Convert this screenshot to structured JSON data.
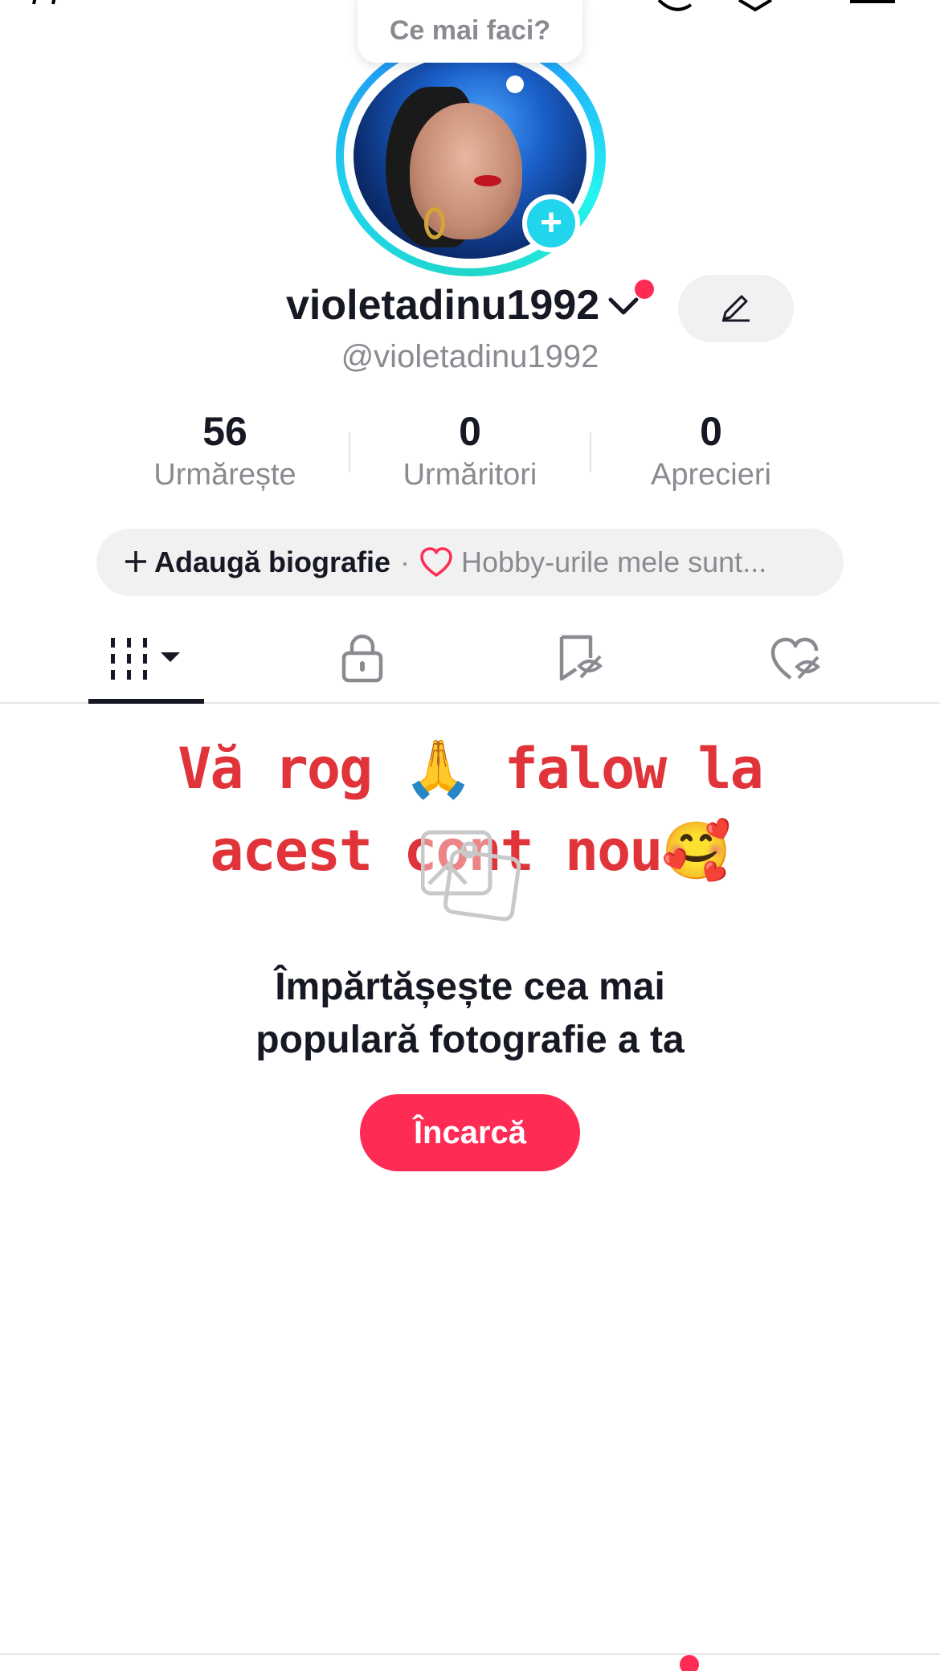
{
  "profile": {
    "username": "violetadinu1992",
    "handle": "@violetadinu1992",
    "bubble_text": "Ce mai faci?",
    "edit_icon": "pencil-icon"
  },
  "stats": {
    "following": {
      "value": "56",
      "label": "Urmărește"
    },
    "followers": {
      "value": "0",
      "label": "Urmăritori"
    },
    "likes": {
      "value": "0",
      "label": "Aprecieri"
    }
  },
  "bio": {
    "add_label": "Adaugă biografie",
    "separator": "·",
    "hobby_placeholder": "Hobby-urile mele sunt..."
  },
  "tabs": [
    {
      "name": "videos-grid",
      "icon": "grid-icon",
      "active": true
    },
    {
      "name": "private",
      "icon": "lock-icon",
      "active": false
    },
    {
      "name": "saved",
      "icon": "bookmark-hidden-icon",
      "active": false
    },
    {
      "name": "liked",
      "icon": "heart-hidden-icon",
      "active": false
    }
  ],
  "content": {
    "promo_line1": "Vă rog 🙏 falow la",
    "promo_line2": "acest cont nou🥰",
    "empty_line1": "Împărtășește cea mai",
    "empty_line2": "populară fotografie a ta",
    "upload_label": "Încarcă"
  },
  "colors": {
    "accent": "#fe2c55",
    "teal": "#20d5ec",
    "muted": "#8a8b91",
    "promo_red": "#e0343a"
  }
}
